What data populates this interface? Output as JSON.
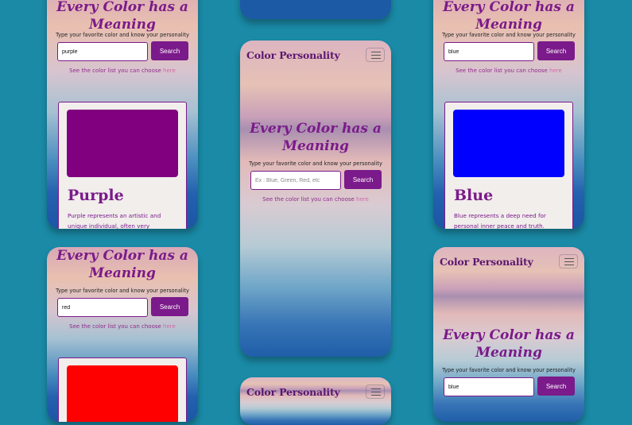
{
  "colors": {
    "background": "#1a8aa6",
    "accent": "#7b1a8a",
    "link": "#d26aa6",
    "swatch_purple": "#800080",
    "swatch_blue": "#0000ff",
    "swatch_red": "#ff0000"
  },
  "screens": {
    "left_top": {
      "hero_title": "Every Color has a Meaning",
      "subtitle": "Type your favorite color and know your personality",
      "search_value": "purple",
      "search_button": "Search",
      "see_text": "See the color list you can choose",
      "see_link": "here",
      "result_name": "Purple",
      "result_desc": "Purple represents an artistic and unique individual, often very"
    },
    "left_bottom": {
      "hero_title": "Every Color has a Meaning",
      "subtitle": "Type your favorite color and know your personality",
      "search_value": "red",
      "search_button": "Search",
      "see_text": "See the color list you can choose",
      "see_link": "here"
    },
    "center": {
      "brand": "Color Personality",
      "menu_icon": "hamburger-icon",
      "hero_title": "Every Color has a Meaning",
      "subtitle": "Type your favorite color and know your personality",
      "search_placeholder": "Ex : Blue, Green, Red, etc",
      "search_button": "Search",
      "see_text": "See the color list you can choose",
      "see_link": "here"
    },
    "center_bottom": {
      "brand": "Color Personality"
    },
    "right_top": {
      "hero_title": "Every Color has a Meaning",
      "subtitle": "Type your favorite color and know your personality",
      "search_value": "blue",
      "search_button": "Search",
      "see_text": "See the color list you can choose",
      "see_link": "here",
      "result_name": "Blue",
      "result_desc": "Blue represents a deep need for personal inner peace and truth."
    },
    "right_bottom": {
      "brand": "Color Personality",
      "menu_icon": "hamburger-icon",
      "hero_title": "Every Color has a Meaning",
      "subtitle": "Type your favorite color and know your personality",
      "search_value": "blue",
      "search_button": "Search"
    }
  }
}
